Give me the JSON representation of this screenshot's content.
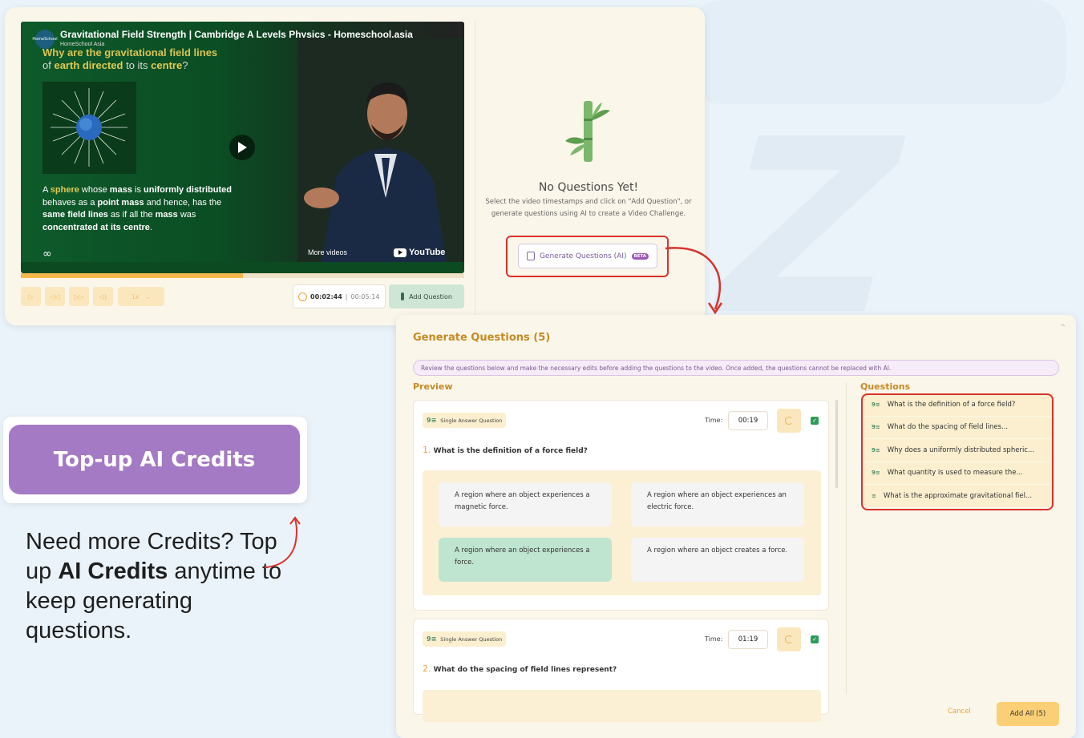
{
  "video": {
    "title": "Gravitational Field Strength | Cambridge A Levels Physics - Homeschool.asia",
    "channel": "HomeSchool Asia",
    "channel_logo": "HomeSchool",
    "question_line1": "Why are the gravitational field lines",
    "question_line2_a": "of",
    "question_line2_b": "earth directed",
    "question_line2_c": "to its",
    "question_line2_d": "centre",
    "question_line2_e": "?",
    "body_line1_a": "A ",
    "body_line1_b": "sphere",
    "body_line1_c": " whose ",
    "body_line1_d": "mass",
    "body_line1_e": " is ",
    "body_line1_f": "uniformly distributed",
    "body_line2_a": "behaves as a ",
    "body_line2_b": "point mass",
    "body_line2_c": " and hence, has the",
    "body_line3_a": "same field lines",
    "body_line3_b": " as if all the ",
    "body_line3_c": "mass",
    "body_line3_d": " was",
    "body_line4": "concentrated at its centre",
    "body_line4_end": ".",
    "more_videos": "More videos",
    "youtube": "YouTube",
    "progress_fraction": 0.5
  },
  "controls": {
    "speed": "1x",
    "current_time": "00:02:44",
    "separator": "|",
    "total_time": "00:05:14",
    "add_question": "Add Question"
  },
  "empty_state": {
    "title": "No Questions Yet!",
    "description": "Select the video timestamps and click on \"Add Question\", or generate questions using AI to create a Video Challenge.",
    "generate_button": "Generate Questions (AI)",
    "beta": "BETA"
  },
  "generate": {
    "title": "Generate Questions (5)",
    "notice": "Review the questions below and make the necessary edits before adding the questions to the video. Once added, the questions cannot be replaced with AI.",
    "preview_label": "Preview",
    "questions_label": "Questions",
    "time_label": "Time:",
    "cancel": "Cancel",
    "add_all": "Add All (5)",
    "preview": [
      {
        "type": "Single Answer Question",
        "time": "00:19",
        "num": "1.",
        "text": "What is the definition of a force field?",
        "options": [
          "A region where an object experiences a magnetic force.",
          "A region where an object experiences an electric force.",
          "A region where an object experiences a force.",
          "A region where an object creates a force."
        ]
      },
      {
        "type": "Single Answer Question",
        "time": "01:19",
        "num": "2.",
        "text": "What do the spacing of field lines represent?"
      }
    ],
    "question_list": [
      "What is the definition of a force field?",
      "What do the spacing of field lines...",
      "Why does a uniformly distributed spheric...",
      "What quantity is used to measure the...",
      "What is the approximate gravitational fiel..."
    ]
  },
  "topup": {
    "button": "Top-up AI Credits",
    "text_a": "Need more Credits? Top up ",
    "text_b": "AI Credits",
    "text_c": " anytime to keep generating questions."
  }
}
